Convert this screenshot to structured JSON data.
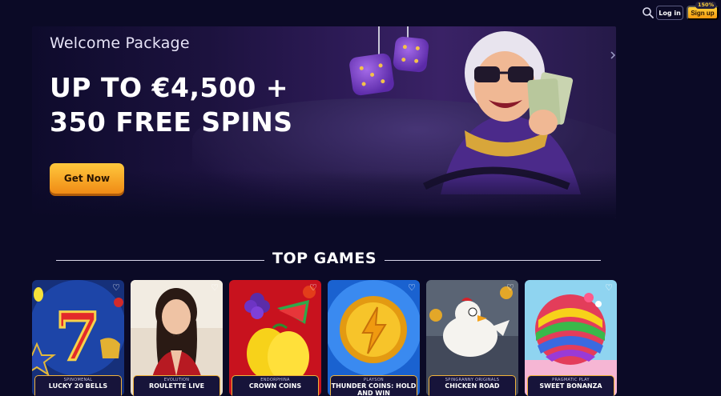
{
  "header": {
    "search_icon": "search-icon",
    "login_label": "Log in",
    "signup_label": "Sign up",
    "signup_badge": "150%"
  },
  "hero": {
    "eyebrow": "Welcome Package",
    "headline_line1": "UP TO €4,500 +",
    "headline_line2": "350 FREE SPINS",
    "cta_label": "Get Now"
  },
  "top_games": {
    "title": "TOP GAMES",
    "cards": [
      {
        "provider": "Spinomenal",
        "name": "LUCKY 20 BELLS"
      },
      {
        "provider": "Evolution",
        "name": "ROULETTE LIVE"
      },
      {
        "provider": "Endorphina",
        "name": "CROWN COINS"
      },
      {
        "provider": "Playson",
        "name": "THUNDER COINS: HOLD AND WIN"
      },
      {
        "provider": "Spingranny Originals",
        "name": "CHICKEN ROAD"
      },
      {
        "provider": "Pragmatic Play",
        "name": "SWEET BONANZA"
      }
    ]
  },
  "colors": {
    "background": "#0b0a26",
    "accent_orange": "#f59a0f",
    "card_border": "#f0b23a"
  }
}
